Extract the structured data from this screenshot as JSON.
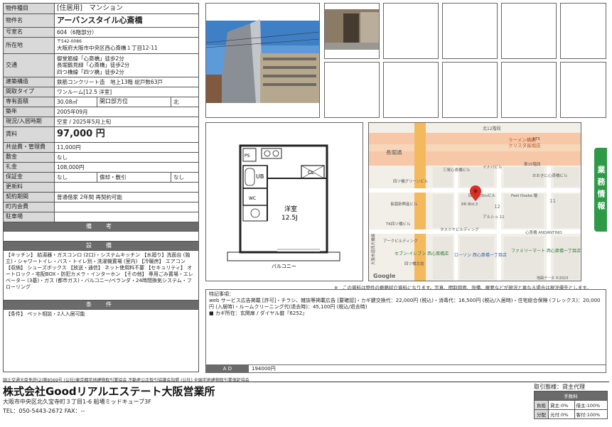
{
  "spec": {
    "type_label": "物件種目",
    "type_value": "[住居用]　マンション",
    "name_label": "物件名",
    "name_value": "アーバンスタイル心斎橋",
    "room_label": "号室名",
    "room_value": "604（6階部分）",
    "loc_label": "所在地",
    "loc_zip": "〒542-0086",
    "loc_value": "大阪府大阪市中央区西心斎橋１丁目12-11",
    "traffic_label": "交通",
    "traffic_lines": [
      "御堂筋線「心斎橋」徒歩2分",
      "長堀鶴見緑「心斎橋」徒歩2分",
      "四つ橋線「四ツ橋」徒歩2分"
    ],
    "struct_label": "建築構造",
    "struct_value": "鉄筋コンクリート造　地上13階 総戸数63戸",
    "layout_label": "間取タイプ",
    "layout_value": "ワンルーム[12.5 洋室]",
    "area_label": "専有面積",
    "area_value": "30.08㎡",
    "dir_label": "開口部方位",
    "dir_value": "北",
    "built_label": "築年",
    "built_value": "2005年09月",
    "status_label": "現況/入居時期",
    "status_value": "空室 / 2025年5月上旬",
    "rent_label": "賃料",
    "rent_value": "97,000 円",
    "fee_label": "共益費・管理費",
    "fee_value": "11,000円",
    "deposit_label": "敷金",
    "deposit_value": "なし",
    "key_label": "礼金",
    "key_value": "108,000円",
    "guar_label": "保証金",
    "guar_value": "なし",
    "amort_label": "償却・敷引",
    "amort_value": "なし",
    "renew_label": "更新料",
    "renew_value": "",
    "contract_label": "契約期間",
    "contract_value": "普通借家 2年間 再契約可能",
    "town_label": "町内会費",
    "town_value": "",
    "parking_label": "駐車場",
    "parking_value": "",
    "remarks_header": "備　考",
    "equip_header": "設　備",
    "equip_text": "【キッチン】 給湯器・ガスコンロ (2口)・システムキッチン 【水廻り】洗面台 (独立)・シャワートイレ・バス・トイレ別・洗濯機置場 (室内) 【冷暖房】 エアコン 【収納】 シューズボックス 【放送・通信】 ネット使用料不要 【セキュリティ】 オートロック・宅配BOX・防犯カメラ・インターホン 【その他】 専用ごみ置場・エレベーター (3基)・ガス (都市ガス)・バルコニー/ベランダ・24時間換気システム・フローリング",
    "cond_header": "条　件",
    "cond_text": "【条件】 ペット相談・2人入居可能"
  },
  "floorplan": {
    "room_name": "洋室",
    "room_size": "12.5J",
    "ub": "UB",
    "cl": "CL",
    "wc": "WC",
    "ps": "PS",
    "balcony": "バルコニー"
  },
  "map": {
    "labels": [
      "北12階段",
      "ラーメン横綱",
      "クリスタ長堀店",
      "長堀通",
      "三栄心斎橋ビル",
      "イナバビル",
      "四ツ橋グリーンビル",
      "長堀新興産ビル",
      "東15階段",
      "おおきに心斎橋ビル",
      "四ツ橋Shuビル",
      "Feel Osaka 優",
      "8R Bld.3",
      "アルシュ 11",
      "TK四ツ橋ビル",
      "タスミヤビルディング",
      "心斎橋 ANDANTINO",
      "アークビルディング",
      "セブン-イレブン 西心斎橋店",
      "ローソン 西心斎橋一丁目店",
      "ファミリーマート 西心斎橋一丁目店",
      "四ツ橋北詰",
      "大阪市道西大橋線",
      "Google",
      "地図データ ©2023",
      "12",
      "11",
      "173"
    ]
  },
  "sidetab": "業務情報",
  "note": "※　この資料は物件の概略紹介資料になります。写真、間取図面、設備、概要などが現況と異なる場合は現況優先とします。",
  "remarks": {
    "title": "特記事項：",
    "lines": [
      "web サービス広告掲載 [許可]・チラシ、雑誌等掲載広告 [要確認]・カギ鍵交換代：22,000円 (税込)・消毒代：16,500円 (税込/入居時)・住宅総合保険 (フレックス)：20,000円 (入居時)・ルームクリーニング代(退去時)：45,100円 (税込/退去時)",
      "■ カギ所在：玄関扉 / ダイヤル錠『6252』"
    ]
  },
  "ad": {
    "label": "A D",
    "value": "194000円"
  },
  "footer": {
    "assoc": "国土交通大臣免許(2)第8569号 (公社)東京都宅地建物取引業協会 不動産公正取引協議会加盟 (公社) 全国宅地建物取引業保証協会",
    "company": "株式会社Goodリアルエステート大阪営業所",
    "address": "大阪市中央区北久宝寺町３丁目1-6 船場ミッドキューブ3F",
    "tel": "TEL：050-5443-2672 FAX：--",
    "transaction": "取引態様：貸主代理",
    "fee_header": "手数料",
    "fee_rows": [
      {
        "label": "負担",
        "col1": "貸主:0%",
        "col2": "借主:100%"
      },
      {
        "label": "分配",
        "col1": "元付:0%",
        "col2": "客付:100%"
      }
    ]
  },
  "colors": {
    "header_gray": "#6b6b6b",
    "label_gray": "#d9d9d9",
    "tab_green": "#2e9a48",
    "map_pin": "#d93025"
  }
}
